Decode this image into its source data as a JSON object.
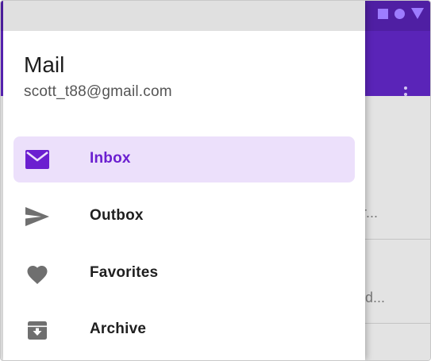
{
  "drawer": {
    "title": "Mail",
    "email": "scott_t88@gmail.com",
    "items": [
      {
        "label": "Inbox",
        "icon": "mail-icon",
        "active": true
      },
      {
        "label": "Outbox",
        "icon": "send-icon",
        "active": false
      },
      {
        "label": "Favorites",
        "icon": "heart-icon",
        "active": false
      },
      {
        "label": "Archive",
        "icon": "archive-icon",
        "active": false
      }
    ]
  },
  "background": {
    "list_snippets": [
      "r...",
      "ld..."
    ],
    "status_icons": [
      "square-icon",
      "circle-icon",
      "triangle-icon"
    ],
    "overflow_icon": "more-vert-icon"
  },
  "colors": {
    "accent": "#6b1fd0",
    "active_bg": "#ece0fb",
    "app_bar": "#5a24b8",
    "inactive_icon": "#6f6f6f"
  }
}
